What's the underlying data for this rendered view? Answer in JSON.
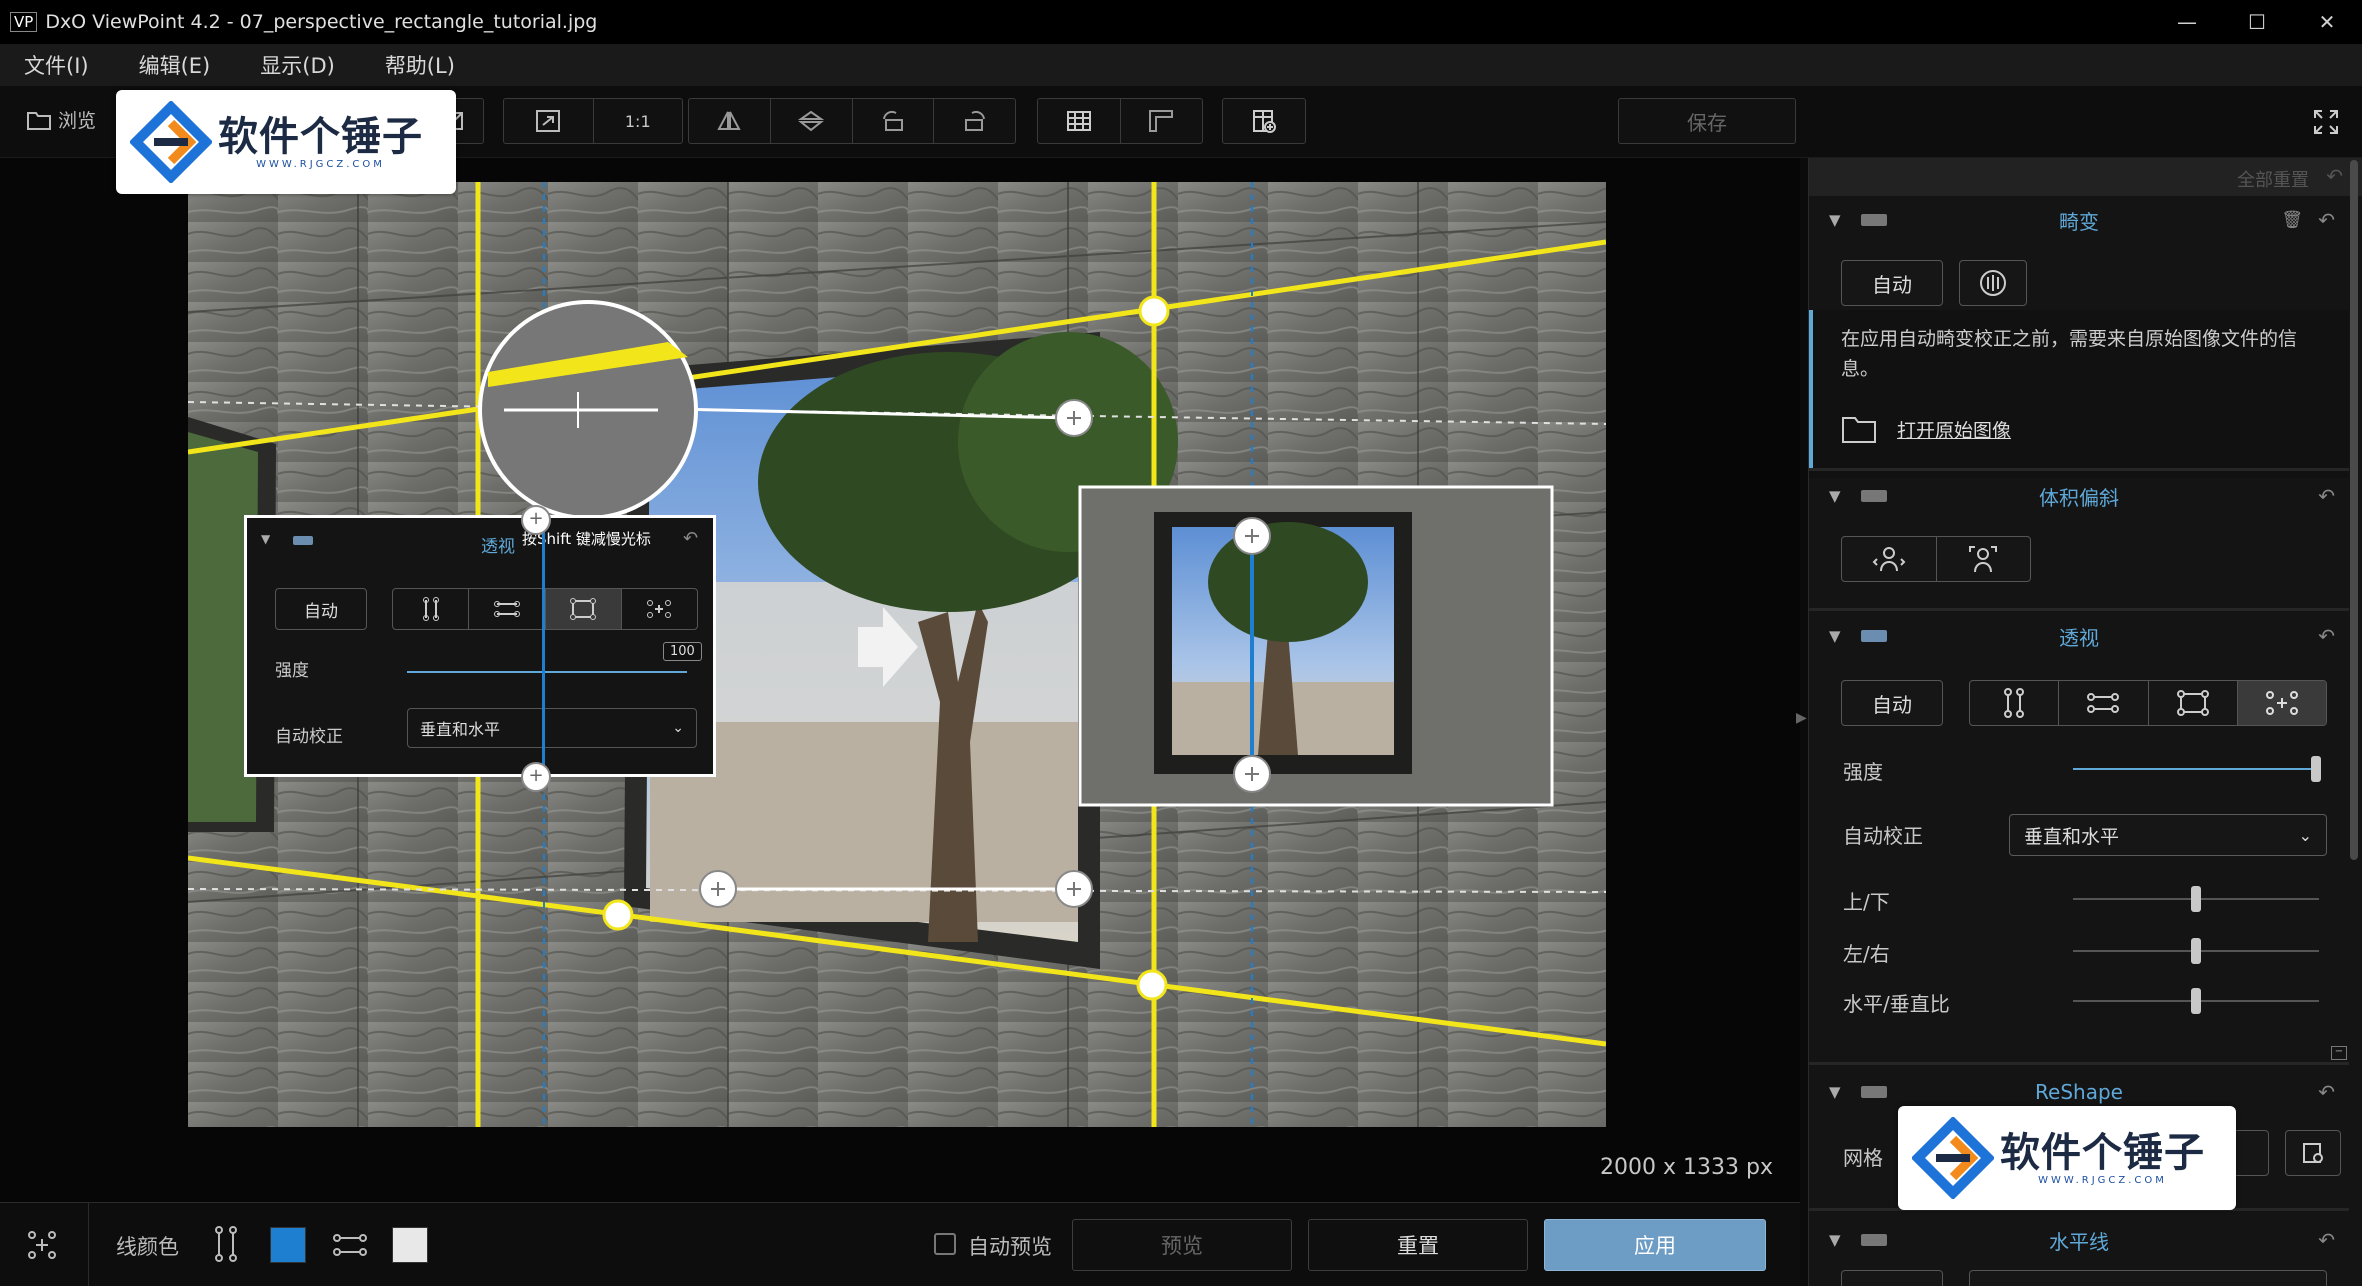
{
  "window": {
    "icon_label": "VP",
    "title": "DxO ViewPoint 4.2 - 07_perspective_rectangle_tutorial.jpg",
    "controls": [
      "—",
      "☐",
      "✕"
    ]
  },
  "menu": [
    "文件(I)",
    "编辑(E)",
    "显示(D)",
    "帮助(L)"
  ],
  "toolbar": {
    "browse_label": "浏览",
    "zoom_label": "1:1",
    "save_label": "保存"
  },
  "watermark": {
    "main": "软件个锤子",
    "sub": "WWW.RJGCZ.COM"
  },
  "canvas": {
    "image_size": "2000 x 1333 px"
  },
  "overlay_panel": {
    "title": "透视",
    "hint": "按Shift 键减慢光标",
    "auto_label": "自动",
    "strength_label": "强度",
    "strength_value": "100",
    "auto_correct_label": "自动校正",
    "auto_correct_value": "垂直和水平"
  },
  "bottombar": {
    "line_color_label": "线颜色",
    "vertical_line_color": "#1e7fd0",
    "horizontal_line_color": "#e8e8e8",
    "auto_preview_label": "自动预览",
    "preview_label": "预览",
    "reset_label": "重置",
    "apply_label": "应用"
  },
  "right_panel": {
    "reset_all_label": "全部重置",
    "distortion": {
      "title": "畸变",
      "auto_label": "自动",
      "info_text": "在应用自动畸变校正之前，需要来自原始图像文件的信息。",
      "open_original_label": "打开原始图像"
    },
    "volume_deformation": {
      "title": "体积偏斜"
    },
    "perspective": {
      "title": "透视",
      "auto_label": "自动",
      "strength_label": "强度",
      "strength_value": 1.0,
      "auto_correct_label": "自动校正",
      "auto_correct_value": "垂直和水平",
      "sliders": [
        {
          "label": "上/下",
          "value": 0.5
        },
        {
          "label": "左/右",
          "value": 0.5
        },
        {
          "label": "水平/垂直比",
          "value": 0.5
        }
      ]
    },
    "reshape": {
      "title": "ReShape",
      "grid_label": "网格"
    },
    "horizon": {
      "title": "水平线"
    }
  },
  "colors": {
    "accent_blue": "#5fa8d8",
    "guide_yellow": "#f2e61a",
    "apply_button": "#6d9cc4"
  }
}
